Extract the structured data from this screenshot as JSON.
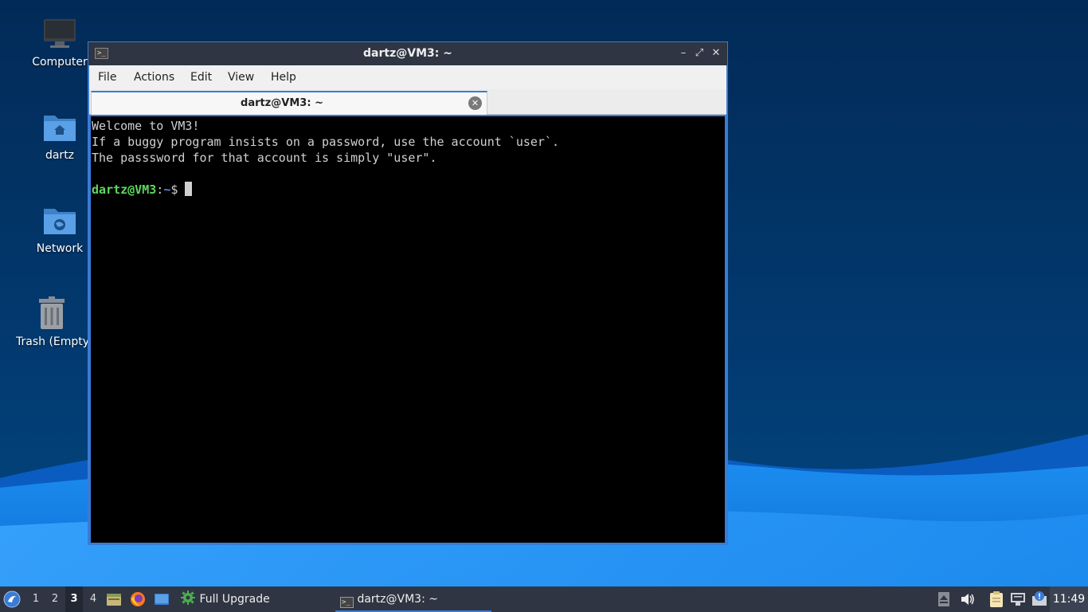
{
  "desktop": {
    "icons": [
      {
        "label": "Computer",
        "icon": "computer-icon"
      },
      {
        "label": "dartz",
        "icon": "home-folder-icon"
      },
      {
        "label": "Network",
        "icon": "network-folder-icon"
      },
      {
        "label": "Trash (Empty)",
        "icon": "trash-icon"
      }
    ]
  },
  "window": {
    "title": "dartz@VM3: ~",
    "controls": {
      "minimize": "–",
      "maximize": "⤢",
      "close": "✕"
    },
    "menu": [
      "File",
      "Actions",
      "Edit",
      "View",
      "Help"
    ],
    "tab": {
      "label": "dartz@VM3: ~",
      "close": "✕"
    }
  },
  "terminal": {
    "lines": [
      "Welcome to VM3!",
      "If a buggy program insists on a password, use the account `user`.",
      "The passsword for that account is simply \"user\"."
    ],
    "prompt": {
      "user_host": "dartz@VM3",
      "sep": ":",
      "path": "~",
      "symbol": "$ "
    }
  },
  "taskbar": {
    "workspaces": [
      "1",
      "2",
      "3",
      "4"
    ],
    "active_workspace": "3",
    "launchers": [
      "file-manager-icon",
      "firefox-icon",
      "desktop-icon"
    ],
    "tasks": [
      {
        "label": "Full Upgrade",
        "icon": "gear-icon"
      },
      {
        "label": "dartz@VM3: ~",
        "icon": "terminal-icon"
      }
    ],
    "tray": [
      "eject-icon",
      "volume-icon",
      "clipboard-icon",
      "network-icon",
      "update-notifier-icon"
    ],
    "clock": "11:49"
  },
  "colors": {
    "accent": "#3a7bd5",
    "panel": "#2f3542",
    "terminal_bg": "#000000",
    "prompt_user": "#5fd75f",
    "prompt_path": "#5f87d7"
  }
}
